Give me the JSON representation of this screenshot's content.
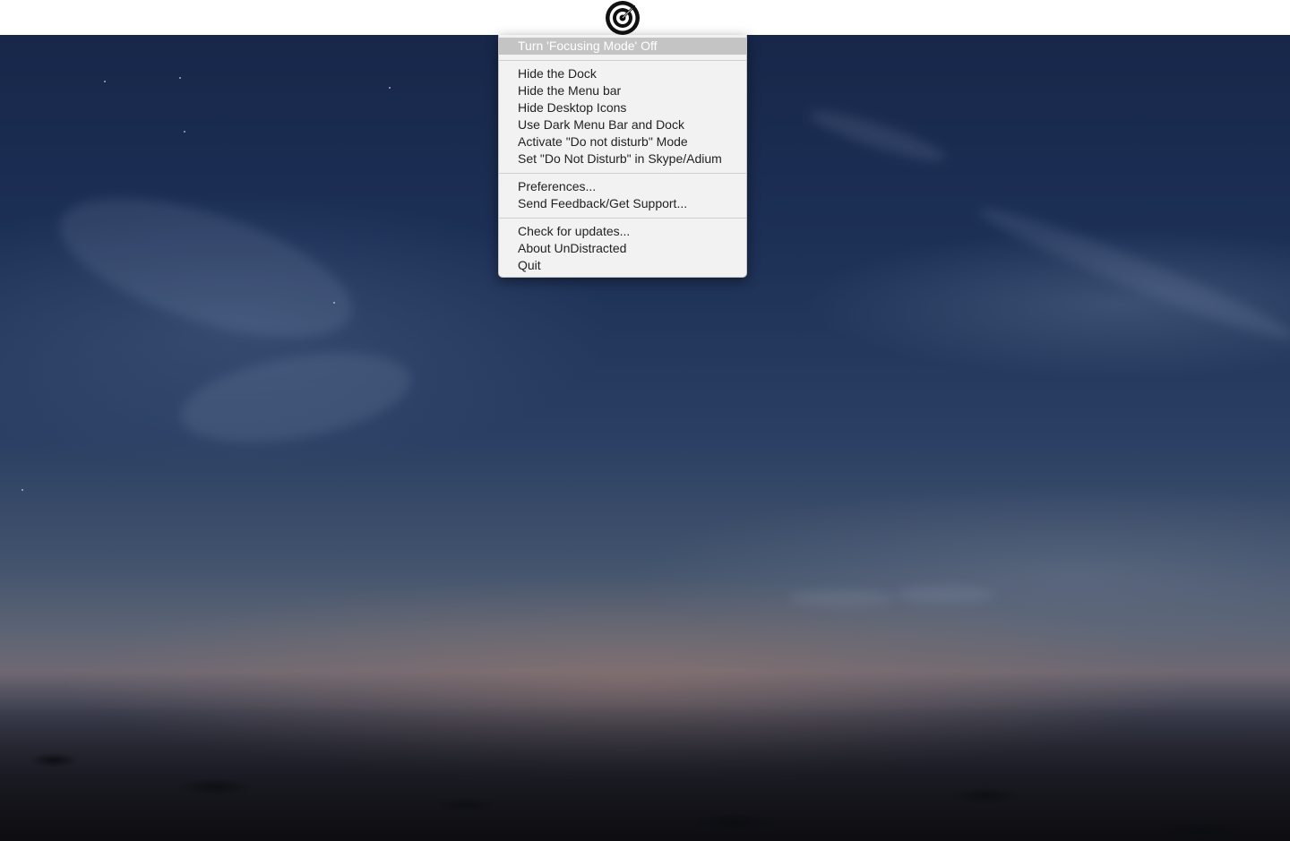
{
  "menubar": {
    "status_icon": "target-icon"
  },
  "menu": {
    "highlighted_item": "Turn 'Focusing Mode' Off",
    "group_view": [
      "Hide the Dock",
      "Hide the Menu bar",
      "Hide Desktop Icons",
      "Use Dark Menu Bar and Dock",
      "Activate \"Do not disturb\" Mode",
      "Set \"Do Not Disturb\" in Skype/Adium"
    ],
    "group_prefs": [
      "Preferences...",
      "Send Feedback/Get Support..."
    ],
    "group_app": [
      "Check for updates...",
      "About UnDistracted",
      "Quit"
    ]
  },
  "colors": {
    "menu_background": "#f2f2f2",
    "highlight": "#c4c4c4",
    "menubar": "#ffffff"
  }
}
